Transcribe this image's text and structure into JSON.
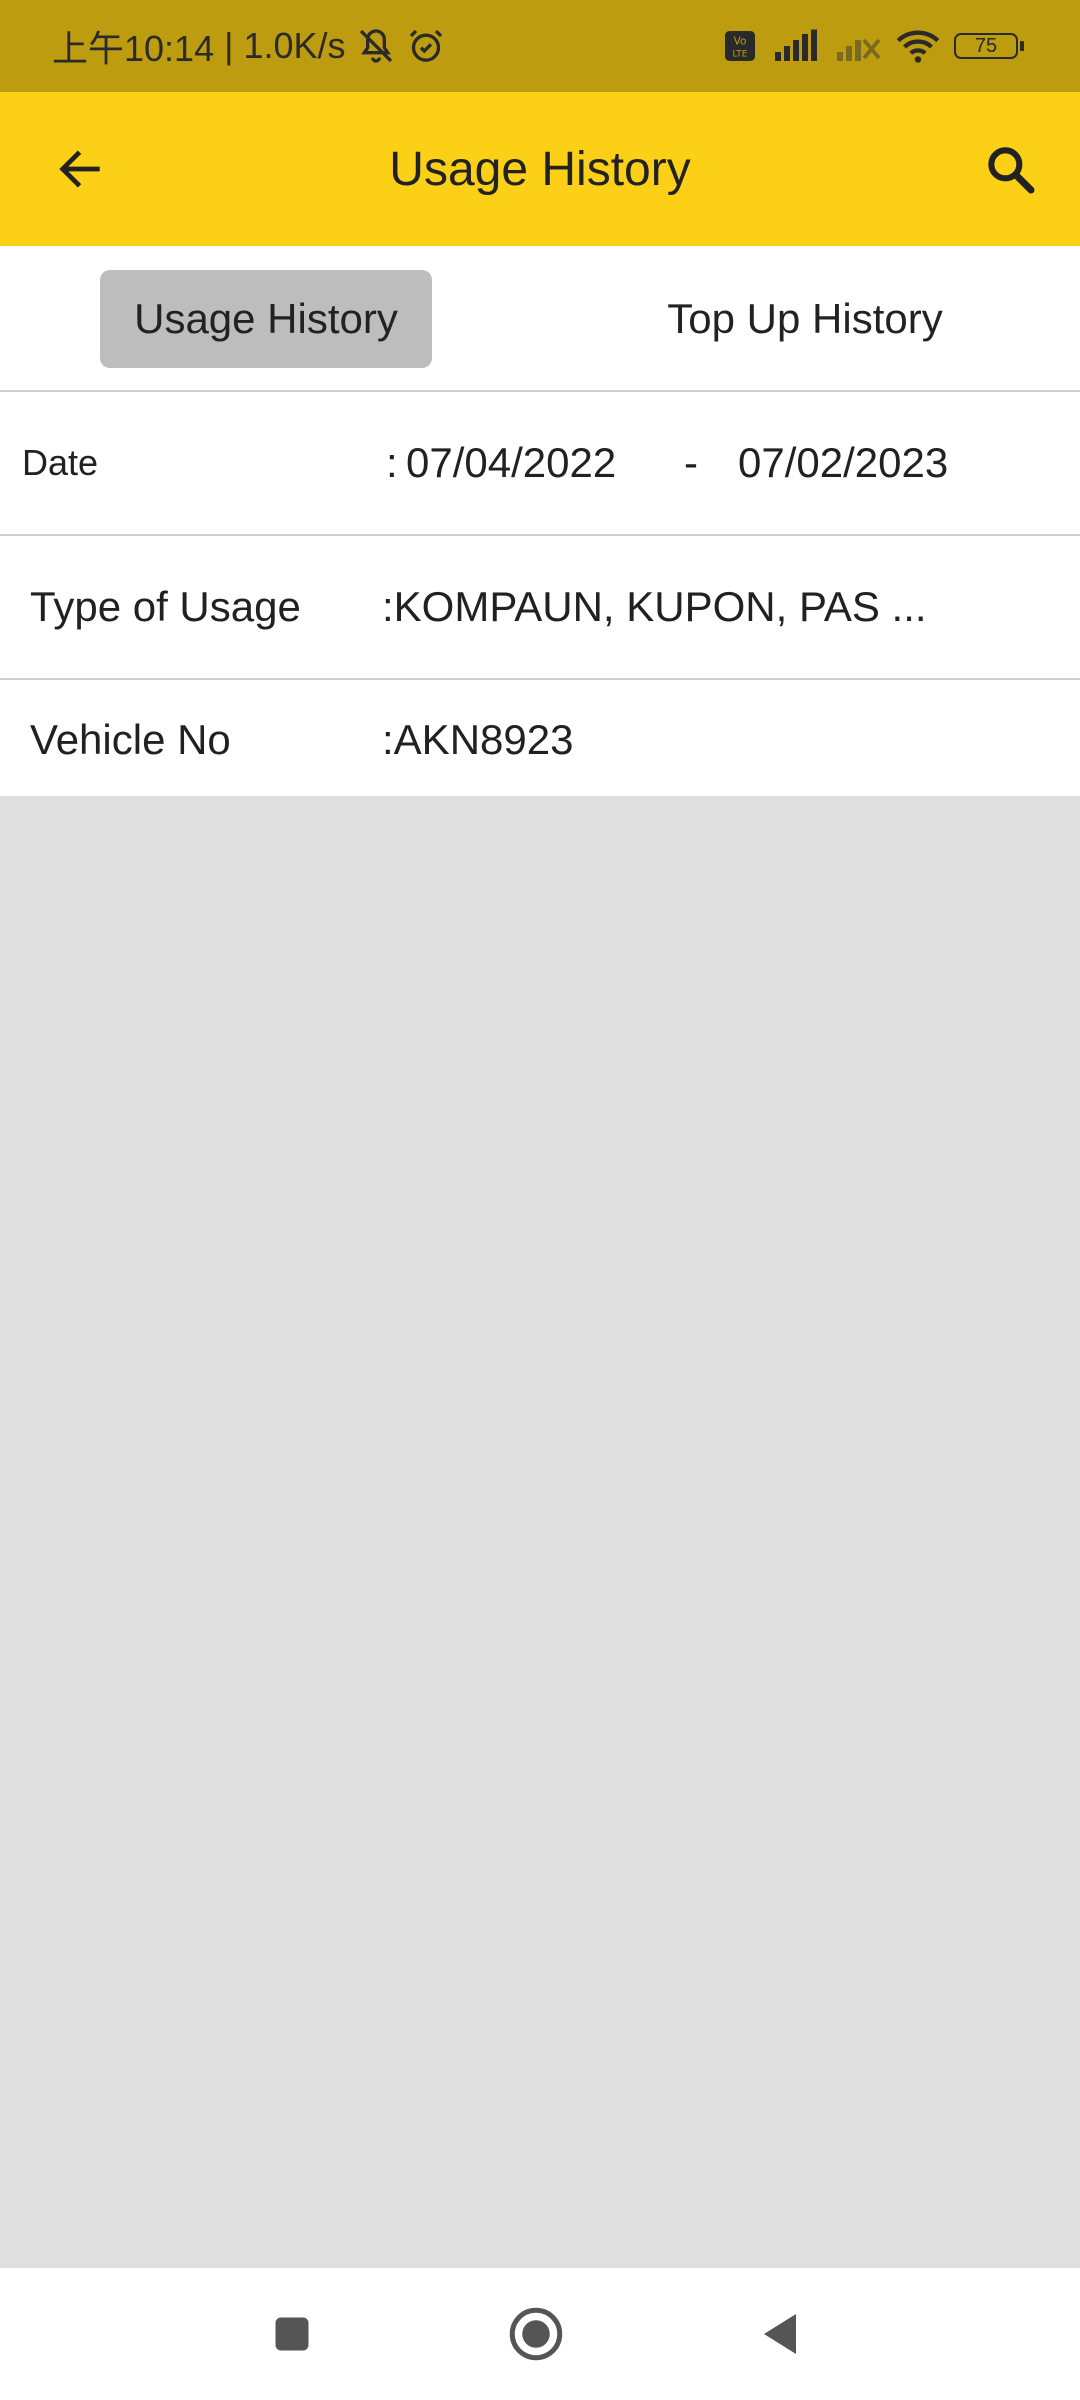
{
  "status_bar": {
    "time": "上午10:14",
    "separator": "|",
    "speed": "1.0K/s",
    "battery": "75"
  },
  "app_bar": {
    "title": "Usage History"
  },
  "tabs": [
    {
      "label": "Usage History",
      "active": true
    },
    {
      "label": "Top Up History",
      "active": false
    }
  ],
  "filters": {
    "date": {
      "label": "Date",
      "colon": ":",
      "from": "07/04/2022",
      "dash": "-",
      "to": "07/02/2023"
    },
    "type": {
      "label": "Type of Usage",
      "value": ":KOMPAUN, KUPON, PAS ..."
    },
    "vehicle": {
      "label": "Vehicle No",
      "value": ":AKN8923"
    }
  },
  "colors": {
    "status_bar": "#bd9d0f",
    "app_bar": "#fbd016",
    "active_tab": "#bdbdbd",
    "background": "#dfdfdf"
  },
  "icons": [
    "back-arrow-icon",
    "search-icon",
    "mute-bell-icon",
    "alarm-icon",
    "volte-icon",
    "signal-icon",
    "signal-no-service-icon",
    "wifi-icon",
    "battery-icon",
    "recents-icon",
    "home-icon",
    "back-icon"
  ]
}
